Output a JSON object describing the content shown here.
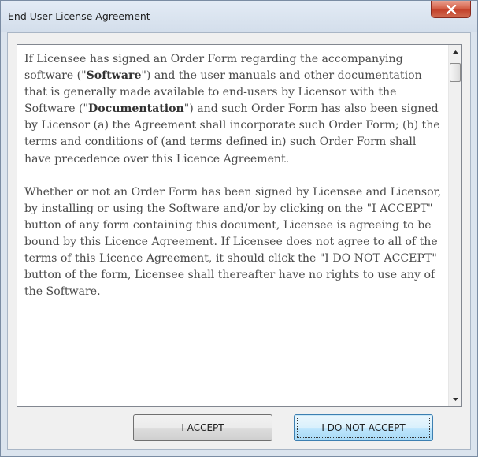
{
  "window": {
    "title": "End User License Agreement",
    "close_icon": "close-x-icon"
  },
  "license": {
    "paragraph1": {
      "t1": "If Licensee has signed an Order Form regarding the accompanying software (\"",
      "b1": "Software",
      "t2": "\") and the user manuals and other documentation that is generally made available to end-users by Licensor with the Software (\"",
      "b2": "Documentation",
      "t3": "\") and such Order Form has also been signed by Licensor (a) the Agreement shall incorporate such Order Form; (b) the terms and conditions of (and terms defined in) such Order Form shall have precedence over this Licence Agreement."
    },
    "paragraph2": "Whether or not an Order Form has been signed by Licensee and Licensor, by installing or using the Software and/or by clicking on the \"I ACCEPT\" button of any form containing this document, Licensee is agreeing to be bound by this Licence Agreement.  If Licensee does not agree to all of the terms of this Licence Agreement, it should click the \"I DO NOT ACCEPT\" button of the form, Licensee shall thereafter have no rights to use any of the Software."
  },
  "scrollbar": {
    "up_icon": "arrow-up-icon",
    "down_icon": "arrow-down-icon"
  },
  "buttons": {
    "accept_label": "I ACCEPT",
    "decline_label": "I DO NOT ACCEPT"
  }
}
